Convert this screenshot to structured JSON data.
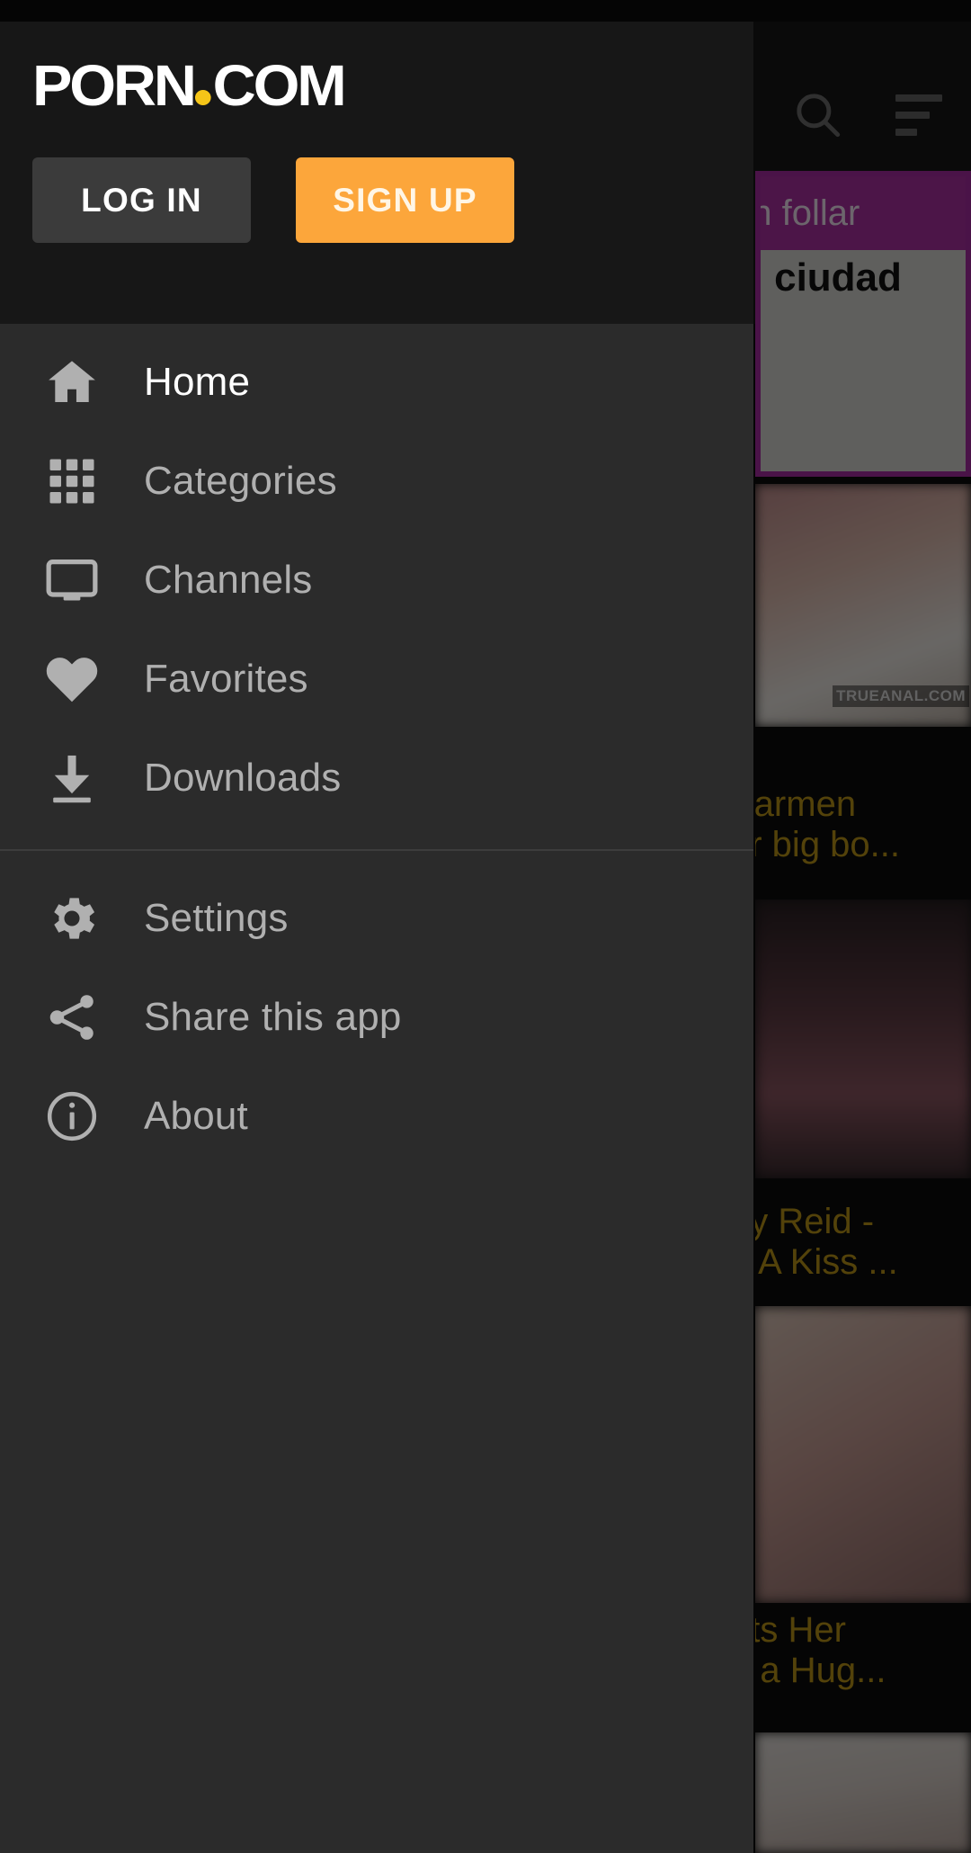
{
  "app": {
    "brand_name_main": "PORN",
    "brand_name_suffix": "COM",
    "accent_color": "#fca63b",
    "logo_dot_color": "#f5c518"
  },
  "header": {
    "login_label": "LOG IN",
    "signup_label": "SIGN UP",
    "search_icon": "search-icon",
    "sort_icon": "sort-lines-icon"
  },
  "drawer": {
    "primary_items": [
      {
        "label": "Home",
        "icon": "home-icon",
        "active": true
      },
      {
        "label": "Categories",
        "icon": "grid-icon",
        "active": false
      },
      {
        "label": "Channels",
        "icon": "tv-icon",
        "active": false
      },
      {
        "label": "Favorites",
        "icon": "heart-icon",
        "active": false
      },
      {
        "label": "Downloads",
        "icon": "download-icon",
        "active": false
      }
    ],
    "secondary_items": [
      {
        "label": "Settings",
        "icon": "gear-icon",
        "active": false
      },
      {
        "label": "Share this app",
        "icon": "share-icon",
        "active": false
      },
      {
        "label": "About",
        "icon": "info-icon",
        "active": false
      }
    ]
  },
  "background": {
    "ad": {
      "headline": "en follar",
      "subline": "u ciudad",
      "banner_color": "#a8309f",
      "body_color": "#d2d2cf"
    },
    "video_titles": [
      "Karmen",
      "er big bo...",
      "ey Reid -",
      "h A Kiss ...",
      "ets Her",
      "h a Hug..."
    ],
    "watermark": "TRUEANAL.COM",
    "title_color": "#b99318"
  }
}
